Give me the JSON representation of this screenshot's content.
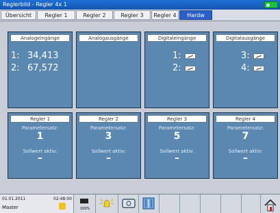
{
  "window": {
    "title": "Reglerbild - Regler 4x 1"
  },
  "tabs": [
    {
      "label": "Übersicht"
    },
    {
      "label": "Regler 1"
    },
    {
      "label": "Regler 2"
    },
    {
      "label": "Regler 3"
    },
    {
      "label": "Regler 4"
    },
    {
      "label": "Hardw",
      "active": true
    }
  ],
  "io": {
    "analog_in": {
      "title": "Analogeingänge",
      "rows": [
        {
          "label": "1:",
          "value": "34,413"
        },
        {
          "label": "2:",
          "value": "67,572"
        }
      ]
    },
    "analog_out": {
      "title": "Analogausgänge"
    },
    "digital_in": {
      "title": "Digitaleingänge",
      "rows": [
        {
          "label": "1:"
        },
        {
          "label": "2:"
        }
      ]
    },
    "digital_out": {
      "title": "Digitalausgänge",
      "rows": [
        {
          "label": "3:"
        },
        {
          "label": "4:"
        }
      ]
    }
  },
  "controllers": [
    {
      "title": "Regler 1",
      "param_label": "Parametersatz:",
      "param": "1",
      "sp_label": "Sollwert aktiv:",
      "sp": "–"
    },
    {
      "title": "Regler 2",
      "param_label": "Parametersatz:",
      "param": "3",
      "sp_label": "Sollwert aktiv:",
      "sp": "–"
    },
    {
      "title": "Regler 3",
      "param_label": "Parametersatz:",
      "param": "5",
      "sp_label": "Sollwert aktiv:",
      "sp": "–"
    },
    {
      "title": "Regler 4",
      "param_label": "Parametersatz:",
      "param": "7",
      "sp_label": "Sollwert aktiv:",
      "sp": "–"
    }
  ],
  "statusbar": {
    "date": "01.01.2011",
    "time": "02:48:00",
    "user": "Master",
    "level": "100%"
  },
  "icons": [
    "memory-icon",
    "alarm-bell-icon",
    "display-icon",
    "archive-icon",
    "home-icon"
  ],
  "colors": {
    "panel": "#5b88b0",
    "title": "#1e6fd6",
    "tab_active": "#2a5fc8"
  }
}
